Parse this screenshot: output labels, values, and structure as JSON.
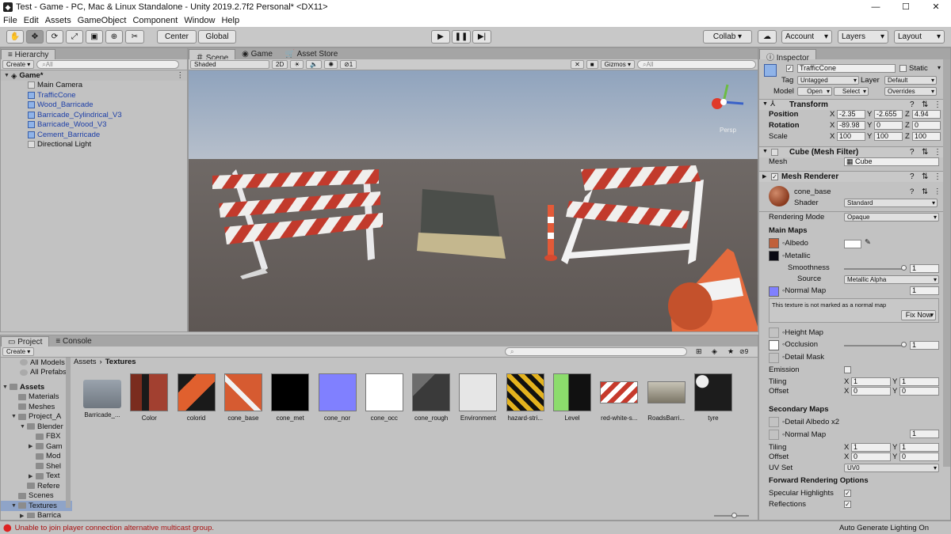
{
  "window": {
    "title": "Test - Game - PC, Mac & Linux Standalone - Unity 2019.2.7f2 Personal* <DX11>"
  },
  "menu": [
    "File",
    "Edit",
    "Assets",
    "GameObject",
    "Component",
    "Window",
    "Help"
  ],
  "toolbar": {
    "center": "Center",
    "global": "Global",
    "collab": "Collab ▾",
    "account": "Account",
    "layers": "Layers",
    "layout": "Layout"
  },
  "hierarchy": {
    "tab": "Hierarchy",
    "create": "Create ▾",
    "search_placeholder": "All",
    "scene": "Game*",
    "items": [
      {
        "name": "Main Camera",
        "prefab": false
      },
      {
        "name": "TrafficCone",
        "prefab": true
      },
      {
        "name": "Wood_Barricade",
        "prefab": true
      },
      {
        "name": "Barricade_Cylindrical_V3",
        "prefab": true
      },
      {
        "name": "Barricade_Wood_V3",
        "prefab": true
      },
      {
        "name": "Cement_Barricade",
        "prefab": true
      },
      {
        "name": "Directional Light",
        "prefab": false
      }
    ]
  },
  "scene": {
    "tabs": [
      "Scene",
      "Game",
      "Asset Store"
    ],
    "shading": "Shaded",
    "mode2d": "2D",
    "fx_count": "1",
    "gizmos": "Gizmos",
    "search_placeholder": "All",
    "persp": "Persp"
  },
  "project": {
    "tabs": [
      "Project",
      "Console"
    ],
    "create": "Create ▾",
    "favorites": [
      "All Models",
      "All Prefabs"
    ],
    "tree": [
      {
        "label": "Assets",
        "indent": 0,
        "fold": "▼",
        "bold": true
      },
      {
        "label": "Materials",
        "indent": 1,
        "fold": ""
      },
      {
        "label": "Meshes",
        "indent": 1,
        "fold": ""
      },
      {
        "label": "Project_A",
        "indent": 1,
        "fold": "▼"
      },
      {
        "label": "Blender",
        "indent": 2,
        "fold": "▼"
      },
      {
        "label": "FBX",
        "indent": 3,
        "fold": ""
      },
      {
        "label": "Gam",
        "indent": 3,
        "fold": "▶"
      },
      {
        "label": "Mod",
        "indent": 3,
        "fold": ""
      },
      {
        "label": "Shel",
        "indent": 3,
        "fold": ""
      },
      {
        "label": "Text",
        "indent": 3,
        "fold": "▶"
      },
      {
        "label": "Refere",
        "indent": 2,
        "fold": ""
      },
      {
        "label": "Scenes",
        "indent": 1,
        "fold": ""
      },
      {
        "label": "Textures",
        "indent": 1,
        "fold": "▼",
        "selected": true
      },
      {
        "label": "Barrica",
        "indent": 2,
        "fold": "▶"
      }
    ],
    "breadcrumb": [
      "Assets",
      "Textures"
    ],
    "assets": [
      "Barricade_...",
      "Color",
      "colorid",
      "cone_base",
      "cone_met",
      "cone_nor",
      "cone_occ",
      "cone_rough",
      "Environment",
      "hazard-stri...",
      "Level",
      "red-white-s...",
      "RoadsBarri...",
      "tyre"
    ],
    "hidden_count": "9"
  },
  "status": {
    "message": "Unable to join player connection alternative multicast group.",
    "right": "Auto Generate Lighting On"
  },
  "inspector": {
    "tab": "Inspector",
    "object_name": "TrafficCone",
    "static": "Static",
    "tag_label": "Tag",
    "tag": "Untagged",
    "layer_label": "Layer",
    "layer": "Default",
    "model_label": "Model",
    "open": "Open",
    "select": "Select",
    "overrides": "Overrides",
    "transform": {
      "title": "Transform",
      "position_label": "Position",
      "position": [
        "-2.35",
        "-2.655",
        "4.94"
      ],
      "rotation_label": "Rotation",
      "rotation": [
        "-89.98",
        "0",
        "0"
      ],
      "scale_label": "Scale",
      "scale": [
        "100",
        "100",
        "100"
      ]
    },
    "mesh_filter": {
      "title": "Cube (Mesh Filter)",
      "mesh_label": "Mesh",
      "mesh": "Cube"
    },
    "mesh_renderer": {
      "title": "Mesh Renderer"
    },
    "material": {
      "name": "cone_base",
      "shader_label": "Shader",
      "shader": "Standard",
      "rendering_mode_label": "Rendering Mode",
      "rendering_mode": "Opaque",
      "main_maps": "Main Maps",
      "albedo": "Albedo",
      "metallic": "Metallic",
      "smoothness_label": "Smoothness",
      "smoothness": "1",
      "smoothness_fraction": 1.0,
      "source_label": "Source",
      "source": "Metallic Alpha",
      "normal_map": "Normal Map",
      "normal_value": "1",
      "normal_warning": "This texture is not marked as a normal map",
      "fix_now": "Fix Now",
      "height_map": "Height Map",
      "occlusion": "Occlusion",
      "occlusion_value": "1",
      "occlusion_fraction": 1.0,
      "detail_mask": "Detail Mask",
      "emission": "Emission",
      "tiling_label": "Tiling",
      "tiling": [
        "1",
        "1"
      ],
      "offset_label": "Offset",
      "offset": [
        "0",
        "0"
      ],
      "secondary_maps": "Secondary Maps",
      "detail_albedo": "Detail Albedo x2",
      "normal_map2": "Normal Map",
      "normal2_value": "1",
      "tiling2": [
        "1",
        "1"
      ],
      "offset2": [
        "0",
        "0"
      ],
      "uvset_label": "UV Set",
      "uvset": "UV0",
      "forward_options": "Forward Rendering Options",
      "specular": "Specular Highlights",
      "reflections": "Reflections"
    }
  },
  "colors": {
    "prefab_blue": "#1d3fa8",
    "albedo": "#c0603a",
    "normal": "#8080ff",
    "selection": "#8fa4c8"
  }
}
